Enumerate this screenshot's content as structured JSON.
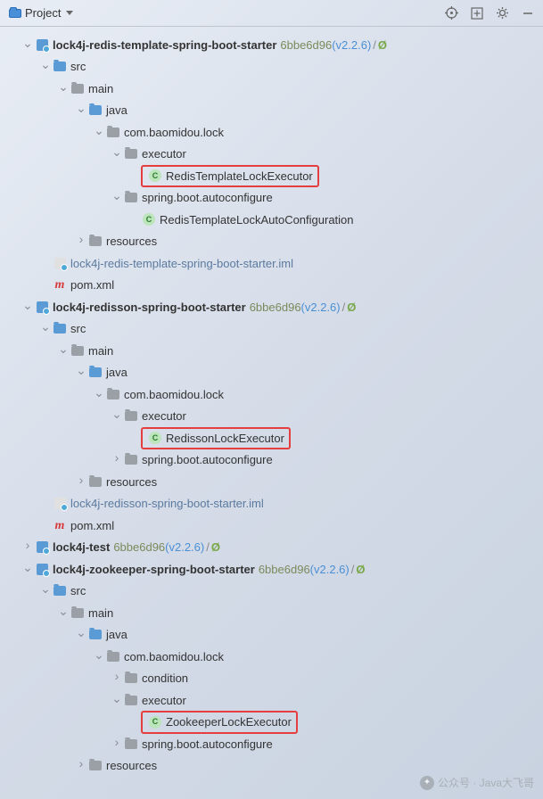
{
  "toolbar": {
    "project_label": "Project"
  },
  "vcs": {
    "hash": "6bbe6d96",
    "version": "(v2.2.6)",
    "null_sym": "Ø"
  },
  "mod1": {
    "name": "lock4j-redis-template-spring-boot-starter",
    "src": "src",
    "main": "main",
    "java": "java",
    "pkg": "com.baomidou.lock",
    "executor": "executor",
    "class1": "RedisTemplateLockExecutor",
    "autocfg": "spring.boot.autoconfigure",
    "class2": "RedisTemplateLockAutoConfiguration",
    "resources": "resources",
    "iml": "lock4j-redis-template-spring-boot-starter.iml",
    "pom": "pom.xml"
  },
  "mod2": {
    "name": "lock4j-redisson-spring-boot-starter",
    "src": "src",
    "main": "main",
    "java": "java",
    "pkg": "com.baomidou.lock",
    "executor": "executor",
    "class1": "RedissonLockExecutor",
    "autocfg": "spring.boot.autoconfigure",
    "resources": "resources",
    "iml": "lock4j-redisson-spring-boot-starter.iml",
    "pom": "pom.xml"
  },
  "mod3": {
    "name": "lock4j-test"
  },
  "mod4": {
    "name": "lock4j-zookeeper-spring-boot-starter",
    "src": "src",
    "main": "main",
    "java": "java",
    "pkg": "com.baomidou.lock",
    "condition": "condition",
    "executor": "executor",
    "class1": "ZookeeperLockExecutor",
    "autocfg": "spring.boot.autoconfigure",
    "resources": "resources"
  },
  "watermark": "公众号 · Java大飞哥"
}
